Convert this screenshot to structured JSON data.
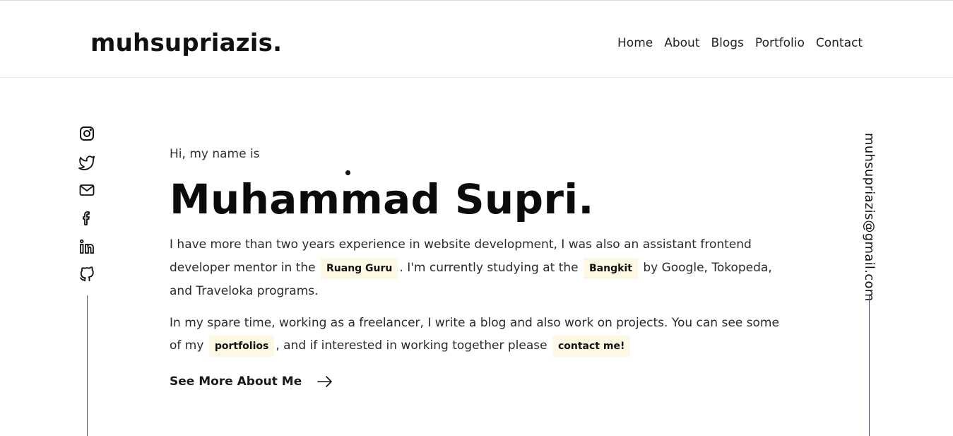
{
  "header": {
    "logo": "muhsupriazis.",
    "nav": [
      "Home",
      "About",
      "Blogs",
      "Portfolio",
      "Contact"
    ]
  },
  "socials": [
    "instagram-icon",
    "twitter-icon",
    "mail-icon",
    "facebook-icon",
    "linkedin-icon",
    "github-icon"
  ],
  "email": "muhsupriazis@gmail.com",
  "hero": {
    "greeting": "Hi, my name is",
    "name": "Muhammad Supri.",
    "p1": {
      "t1": "I have more than two years experience in website development, I was also an assistant frontend developer mentor in the",
      "hl1": "Ruang Guru",
      "t2": ". I'm currently studying at the",
      "hl2": "Bangkit",
      "t3": "by Google, Tokopeda, and Traveloka programs."
    },
    "p2": {
      "t1": "In my spare time, working as a freelancer, I write a blog and also work on projects. You can see some of my",
      "hl1": "portfolios",
      "t2": ", and if interested in working together please",
      "hl2": "contact me!"
    },
    "cta": "See More About Me"
  },
  "colors": {
    "highlight_bg": "#fdf8e4",
    "vertical_line": "#4b5a73"
  }
}
